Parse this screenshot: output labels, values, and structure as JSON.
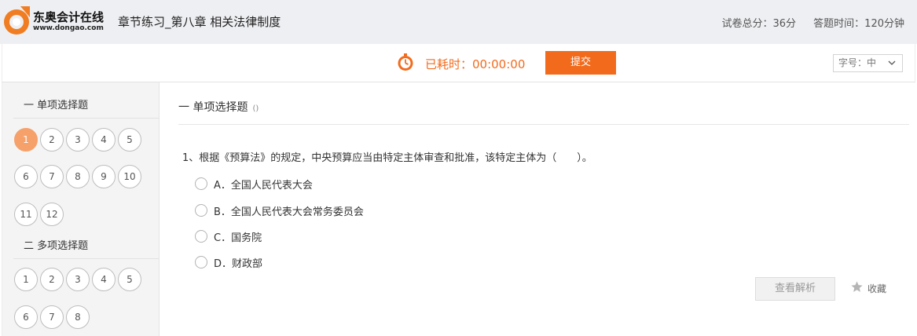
{
  "header": {
    "logo_name": "东奥会计在线",
    "logo_url": "www.dongao.com",
    "title": "章节练习_第八章 相关法律制度",
    "total_score": "试卷总分：36分",
    "answer_time": "答题时间：120分钟"
  },
  "toolbar": {
    "timer": "已耗时：00:00:00",
    "submit_label": "提交",
    "font_size_label": "字号：中"
  },
  "sidebar": {
    "sections": [
      {
        "title": "一 单项选择题",
        "numbers": [
          "1",
          "2",
          "3",
          "4",
          "5",
          "6",
          "7",
          "8",
          "9",
          "10",
          "11",
          "12"
        ],
        "active": "1"
      },
      {
        "title": "二 多项选择题",
        "numbers": [
          "1",
          "2",
          "3",
          "4",
          "5",
          "6",
          "7",
          "8"
        ]
      }
    ]
  },
  "main": {
    "section_title": "一 单项选择题",
    "section_note": "()",
    "question": "1、根据《预算法》的规定，中央预算应当由特定主体审查和批准，该特定主体为（　　）。",
    "options": [
      {
        "label": "A．全国人民代表大会"
      },
      {
        "label": "B．全国人民代表大会常务委员会"
      },
      {
        "label": "C．国务院"
      },
      {
        "label": "D．财政部"
      }
    ],
    "analysis_label": "查看解析",
    "favorite_label": "收藏"
  },
  "colors": {
    "accent": "#f26b1d",
    "active_number": "#f6a06a",
    "header_bg": "#eeeff2",
    "sidebar_bg": "#f4f4f4"
  },
  "icons": [
    "logo-icon",
    "timer-icon",
    "chevron-down-icon",
    "star-icon",
    "radio-icon"
  ]
}
